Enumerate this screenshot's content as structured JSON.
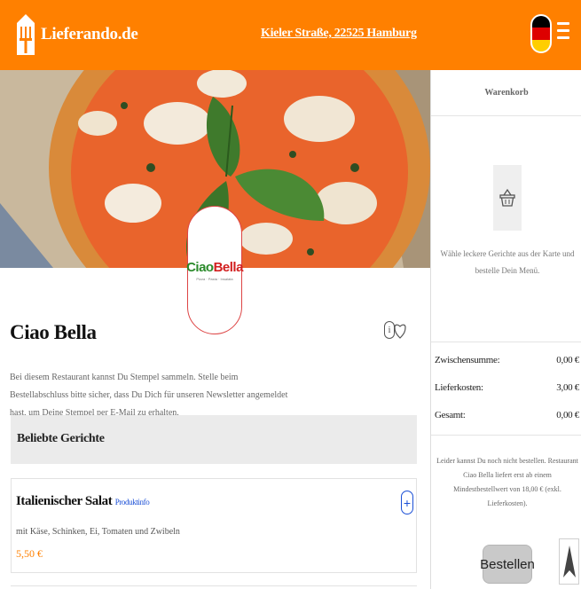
{
  "header": {
    "logo_text": "Lieferando.de",
    "address": "Kieler Straße, 22525 Hamburg",
    "language_flag": "de-flag-icon",
    "menu_icon": "hamburger-menu-icon",
    "colors": {
      "brand": "#ff8000",
      "text": "#ffffff"
    }
  },
  "restaurant": {
    "logo_word_1": "Ciao",
    "logo_word_2": "Bella",
    "logo_tagline": "Pizza · Pasta · Insalata",
    "name": "Ciao Bella",
    "stamp_notice": "Bei diesem Restaurant kannst Du Stempel sammeln. Stelle beim Bestellabschluss bitte sicher, dass Du Dich für unseren Newsletter angemeldet hast, um Deine Stempel per E-Mail zu erhalten."
  },
  "sections": {
    "popular_title": "Beliebte Gerichte"
  },
  "dishes": [
    {
      "name": "Italienischer Salat",
      "info_link": "Produktinfo",
      "description": "mit Käse, Schinken, Ei, Tomaten und Zwibeln",
      "price": "5,50 €"
    }
  ],
  "cart": {
    "title": "Warenkorb",
    "empty_text": "Wähle leckere Gerichte aus der Karte und bestelle Dein Menü.",
    "subtotal_label": "Zwischensumme:",
    "subtotal_value": "0,00 €",
    "delivery_label": "Lieferkosten:",
    "delivery_value": "3,00 €",
    "total_label": "Gesamt:",
    "total_value": "0,00 €",
    "min_order_text": "Leider kannst Du noch nicht bestellen. Restaurant Ciao Bella liefert erst ab einem Mindestbestellwert von 18,00 € (exkl. Lieferkosten).",
    "order_button": "Bestellen"
  }
}
